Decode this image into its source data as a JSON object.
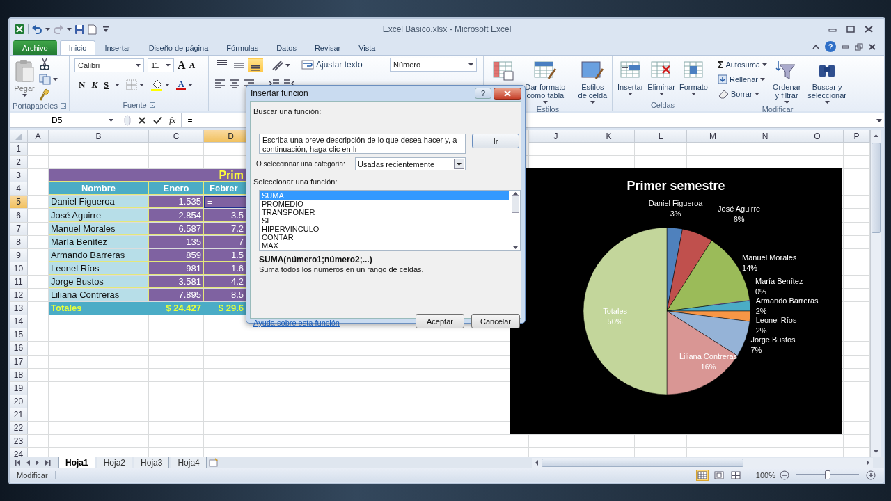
{
  "window": {
    "title": "Excel Básico.xlsx - Microsoft Excel",
    "help": "?"
  },
  "tabs": [
    {
      "label": "Archivo",
      "kind": "file",
      "selected": false
    },
    {
      "label": "Inicio",
      "kind": "tab",
      "selected": true
    },
    {
      "label": "Insertar",
      "kind": "tab",
      "selected": false
    },
    {
      "label": "Diseño de página",
      "kind": "tab",
      "selected": false
    },
    {
      "label": "Fórmulas",
      "kind": "tab",
      "selected": false
    },
    {
      "label": "Datos",
      "kind": "tab",
      "selected": false
    },
    {
      "label": "Revisar",
      "kind": "tab",
      "selected": false
    },
    {
      "label": "Vista",
      "kind": "tab",
      "selected": false
    }
  ],
  "ribbon": {
    "clipboard": {
      "label": "Portapapeles",
      "paste": "Pegar"
    },
    "font": {
      "label": "Fuente",
      "family": "Calibri",
      "size": "11",
      "size_buttons": [
        "A",
        "A"
      ],
      "styles": [
        "N",
        "K",
        "S"
      ],
      "color_button": "A"
    },
    "alignment": {
      "buttons": [
        {
          "selected": false
        },
        {
          "selected": false
        },
        {
          "selected": true
        }
      ],
      "wrap": "Ajustar texto"
    },
    "number": {
      "format": "Número"
    },
    "styles": {
      "label": "Estilos",
      "buttons": [
        "Dar formato como tabla",
        "Estilos de celda"
      ]
    },
    "cells": {
      "label": "Celdas",
      "buttons": [
        "Insertar",
        "Eliminar",
        "Formato"
      ]
    },
    "editing": {
      "label": "Modificar",
      "glyph": "Σ",
      "small_buttons": [
        "Autosuma",
        "Rellenar",
        "Borrar"
      ],
      "buttons": [
        "Ordenar y filtrar",
        "Buscar y seleccionar"
      ]
    }
  },
  "formula_bar": {
    "name_box": "D5",
    "function_button": "fx",
    "formula": "="
  },
  "sheet": {
    "columns": [
      {
        "label": "A",
        "selected": false
      },
      {
        "label": "B",
        "selected": false
      },
      {
        "label": "C",
        "selected": false
      },
      {
        "label": "D",
        "selected": true
      },
      {
        "label": "J",
        "selected": false
      },
      {
        "label": "K",
        "selected": false
      },
      {
        "label": "L",
        "selected": false
      },
      {
        "label": "M",
        "selected": false
      },
      {
        "label": "N",
        "selected": false
      },
      {
        "label": "O",
        "selected": false
      },
      {
        "label": "P",
        "selected": false
      }
    ],
    "rows": [
      {
        "label": "1",
        "selected": false
      },
      {
        "label": "2",
        "selected": false
      },
      {
        "label": "3",
        "selected": false,
        "cells": [
          {
            "kind": "title",
            "text": "Prim"
          }
        ]
      },
      {
        "label": "4",
        "selected": false,
        "cells": [
          {
            "kind": "header",
            "text": "Nombre"
          },
          {
            "kind": "header",
            "text": "Enero"
          },
          {
            "kind": "header",
            "text": "Febrer"
          }
        ]
      },
      {
        "label": "5",
        "selected": true,
        "cells": [
          {
            "kind": "name",
            "text": "Daniel Figueroa"
          },
          {
            "kind": "value",
            "text": "1.535"
          },
          {
            "kind": "active",
            "text": "="
          }
        ]
      },
      {
        "label": "6",
        "selected": false,
        "cells": [
          {
            "kind": "name",
            "text": "José Aguirre"
          },
          {
            "kind": "value",
            "text": "2.854"
          },
          {
            "kind": "value",
            "text": "3.5"
          }
        ]
      },
      {
        "label": "7",
        "selected": false,
        "cells": [
          {
            "kind": "name",
            "text": "Manuel Morales"
          },
          {
            "kind": "value",
            "text": "6.587"
          },
          {
            "kind": "value",
            "text": "7.2"
          }
        ]
      },
      {
        "label": "8",
        "selected": false,
        "cells": [
          {
            "kind": "name",
            "text": "María Benítez"
          },
          {
            "kind": "value",
            "text": "135"
          },
          {
            "kind": "value",
            "text": "7"
          }
        ]
      },
      {
        "label": "9",
        "selected": false,
        "cells": [
          {
            "kind": "name",
            "text": "Armando Barreras"
          },
          {
            "kind": "value",
            "text": "859"
          },
          {
            "kind": "value",
            "text": "1.5"
          }
        ]
      },
      {
        "label": "10",
        "selected": false,
        "cells": [
          {
            "kind": "name",
            "text": "Leonel Ríos"
          },
          {
            "kind": "value",
            "text": "981"
          },
          {
            "kind": "value",
            "text": "1.6"
          }
        ]
      },
      {
        "label": "11",
        "selected": false,
        "cells": [
          {
            "kind": "name",
            "text": "Jorge Bustos"
          },
          {
            "kind": "value",
            "text": "3.581"
          },
          {
            "kind": "value",
            "text": "4.2"
          }
        ]
      },
      {
        "label": "12",
        "selected": false,
        "cells": [
          {
            "kind": "name",
            "text": "Liliana Contreras"
          },
          {
            "kind": "value",
            "text": "7.895"
          },
          {
            "kind": "value",
            "text": "8.5"
          }
        ]
      },
      {
        "label": "13",
        "selected": false,
        "cells": [
          {
            "kind": "total",
            "text": "Totales"
          },
          {
            "kind": "total",
            "text": "$ 24.427"
          },
          {
            "kind": "total",
            "text": "$ 29.6"
          }
        ]
      },
      {
        "label": "14",
        "selected": false
      },
      {
        "label": "15",
        "selected": false
      },
      {
        "label": "16",
        "selected": false
      },
      {
        "label": "17",
        "selected": false
      },
      {
        "label": "18",
        "selected": false
      },
      {
        "label": "19",
        "selected": false
      },
      {
        "label": "20",
        "selected": false
      },
      {
        "label": "21",
        "selected": false
      },
      {
        "label": "22",
        "selected": false
      },
      {
        "label": "23",
        "selected": false
      },
      {
        "label": "24",
        "selected": false
      }
    ]
  },
  "chart": {
    "chart_data": {
      "type": "pie",
      "title": "Primer semestre",
      "categories": [
        "Daniel Figueroa",
        "José Aguirre",
        "Manuel Morales",
        "María Benítez",
        "Armando Barreras",
        "Leonel Ríos",
        "Jorge Bustos",
        "Liliana Contreras",
        "Totales"
      ],
      "values": [
        3,
        6,
        14,
        0,
        2,
        2,
        7,
        16,
        50
      ],
      "value_labels": [
        "3%",
        "6%",
        "14%",
        "0%",
        "2%",
        "2%",
        "7%",
        "16%",
        "50%"
      ]
    }
  },
  "sheet_tabs": [
    {
      "label": "Hoja1",
      "selected": true
    },
    {
      "label": "Hoja2",
      "selected": false
    },
    {
      "label": "Hoja3",
      "selected": false
    },
    {
      "label": "Hoja4",
      "selected": false
    }
  ],
  "status_bar": {
    "mode": "Modificar",
    "views": [
      {
        "selected": true
      },
      {
        "selected": false
      },
      {
        "selected": false
      }
    ],
    "zoom": {
      "reading": "100%",
      "level": 0.5
    }
  },
  "dialog": {
    "title": "Insertar función",
    "help": "?",
    "search_label": "Buscar una función:",
    "search_value": "Escriba una breve descripción de lo que desea hacer y, a continuación, haga clic en Ir",
    "go": "Ir",
    "category_label": "O seleccionar una categoría:",
    "category": "Usadas recientemente",
    "list_label": "Seleccionar una función:",
    "functions": [
      {
        "label": "SUMA",
        "selected": true
      },
      {
        "label": "PROMEDIO",
        "selected": false
      },
      {
        "label": "TRANSPONER",
        "selected": false
      },
      {
        "label": "SI",
        "selected": false
      },
      {
        "label": "HIPERVINCULO",
        "selected": false
      },
      {
        "label": "CONTAR",
        "selected": false
      },
      {
        "label": "MAX",
        "selected": false
      }
    ],
    "signature": "SUMA(número1;número2;...)",
    "description": "Suma todos los números en un rango de celdas.",
    "help_link": "Ayuda sobre esta función",
    "buttons": [
      "Aceptar",
      "Cancelar"
    ]
  }
}
